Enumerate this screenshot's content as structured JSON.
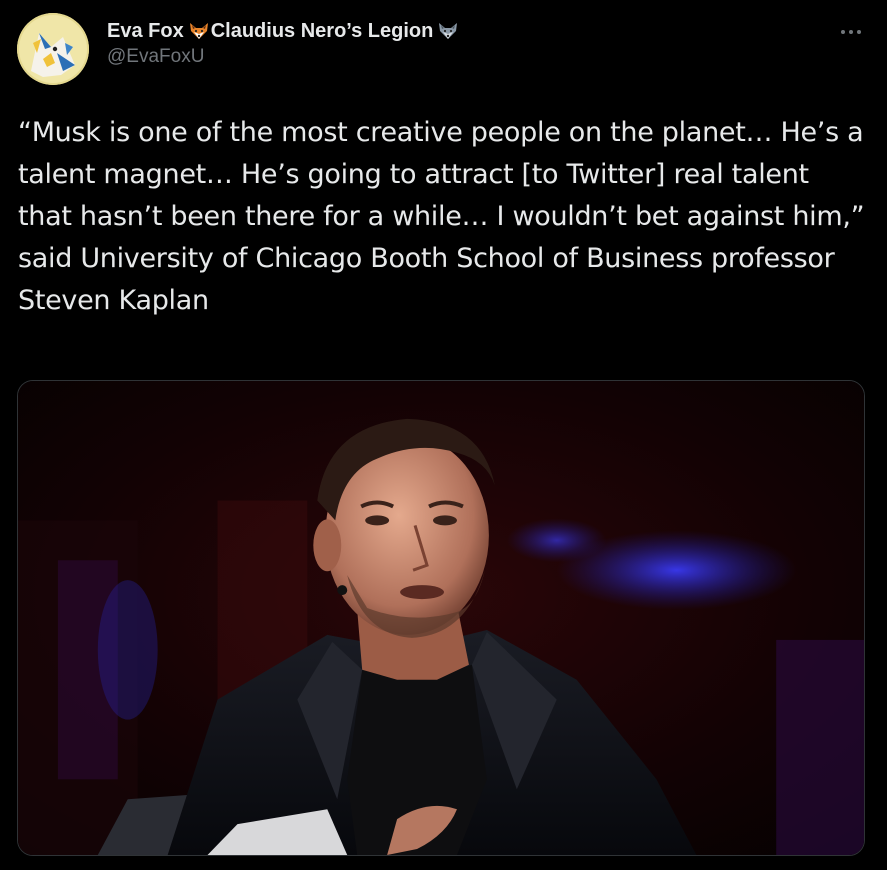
{
  "tweet": {
    "author": {
      "display_name_part1": "Eva Fox",
      "display_name_part2": "Claudius Nero’s Legion",
      "handle": "@EvaFoxU",
      "emoji1_icon": "fox-face-icon",
      "emoji2_icon": "wolf-face-icon"
    },
    "more_icon": "more-options-icon",
    "text": "“Musk is one of the most creative people on the planet… He’s a talent magnet… He’s going to attract [to Twitter] real talent that hasn’t been there for a while… I wouldn’t bet against him,” said University of Chicago Booth School of Business professor Steven Kaplan",
    "media": {
      "type": "photo"
    }
  },
  "colors": {
    "background": "#000000",
    "text": "#e7e9ea",
    "secondary_text": "#71767b",
    "border": "#2f3336"
  }
}
